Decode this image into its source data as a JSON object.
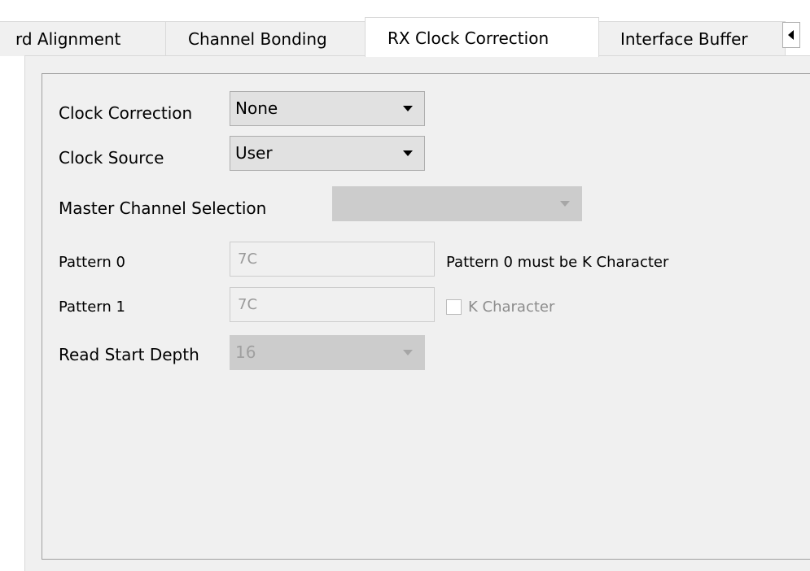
{
  "tabs": [
    {
      "label": "rd Alignment",
      "active": false
    },
    {
      "label": "Channel Bonding",
      "active": false
    },
    {
      "label": "RX Clock Correction",
      "active": true
    },
    {
      "label": "Interface Buffer",
      "active": false
    }
  ],
  "form": {
    "clock_correction": {
      "label": "Clock Correction",
      "value": "None"
    },
    "clock_source": {
      "label": "Clock Source",
      "value": "User"
    },
    "master_channel": {
      "label": "Master Channel Selection",
      "value": ""
    },
    "pattern0": {
      "label": "Pattern 0",
      "value": "7C",
      "note": "Pattern 0 must be K Character"
    },
    "pattern1": {
      "label": "Pattern 1",
      "value": "7C",
      "checkbox_label": "K Character",
      "checked": false
    },
    "read_start_depth": {
      "label": "Read Start Depth",
      "value": "16"
    }
  },
  "icons": {
    "tab_scroll": "triangle-left-icon",
    "dropdown": "triangle-down-icon"
  },
  "colors": {
    "pane_background": "#f0f0f0",
    "disabled_field": "#cccccc",
    "enabled_combo": "#e1e1e1"
  }
}
